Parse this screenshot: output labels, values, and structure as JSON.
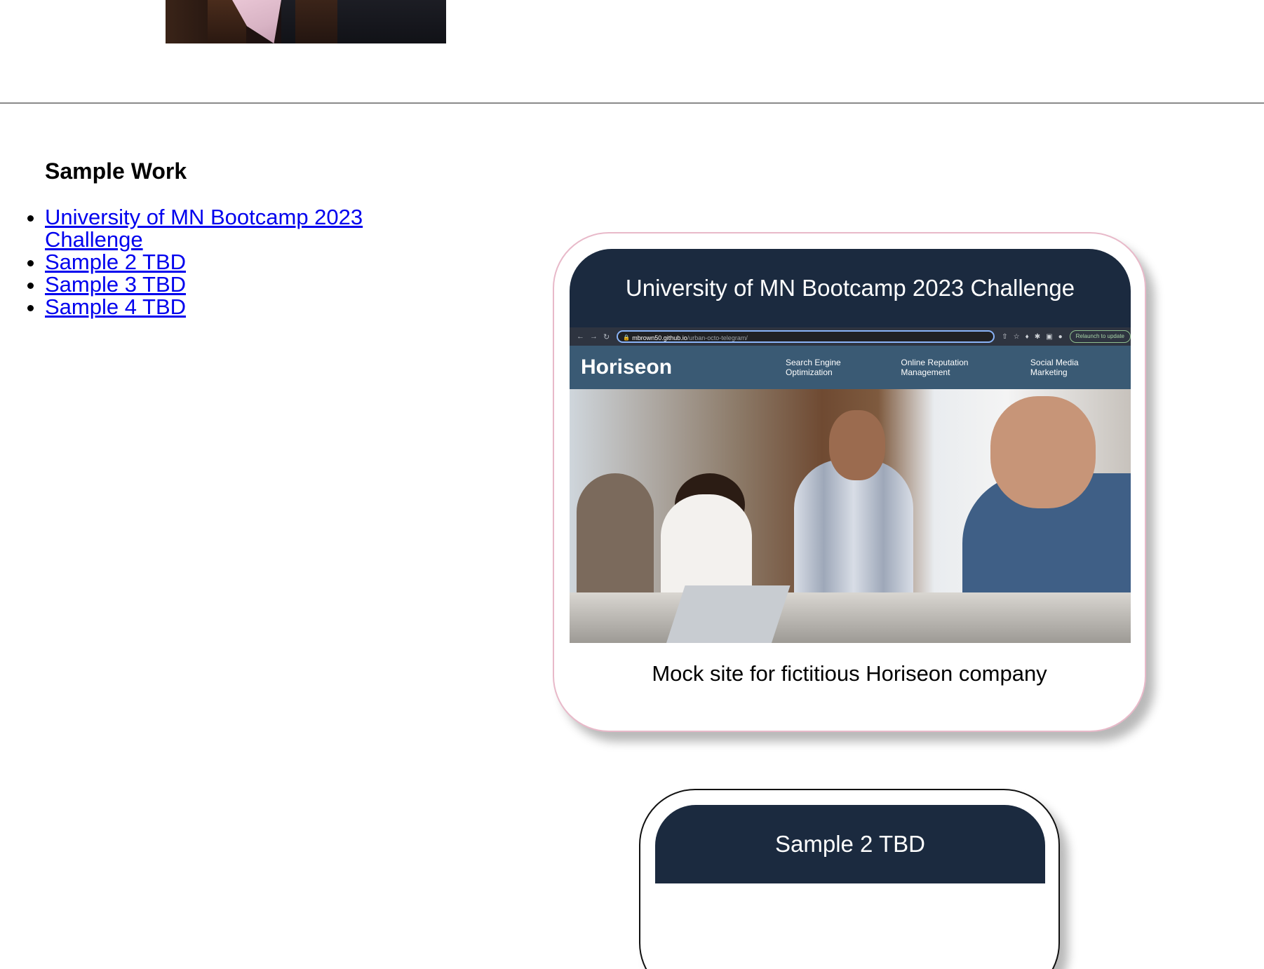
{
  "section": {
    "title": "Sample Work",
    "links": [
      {
        "label": "University of MN Bootcamp 2023 Challenge"
      },
      {
        "label": "Sample 2 TBD"
      },
      {
        "label": "Sample 3 TBD"
      },
      {
        "label": "Sample 4 TBD"
      }
    ]
  },
  "cards": [
    {
      "title": "University of MN Bootcamp 2023 Challenge",
      "caption": "Mock site for fictitious Horiseon company",
      "screenshot": {
        "url_host": "mbrown50.github.io",
        "url_path": "/urban-octo-telegram/",
        "relaunch_label": "Relaunch to update",
        "site_logo": "Horiseon",
        "site_nav": [
          "Search Engine Optimization",
          "Online Reputation Management",
          "Social Media Marketing"
        ]
      }
    },
    {
      "title": "Sample 2 TBD"
    }
  ],
  "colors": {
    "card_header_bg": "#1b2a3f",
    "card1_border": "#e8b9c9",
    "link": "#0000ee"
  }
}
